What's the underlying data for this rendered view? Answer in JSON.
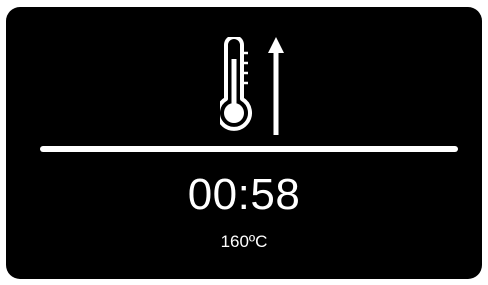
{
  "display": {
    "icon": "thermometer-rising-icon",
    "timer": "00:58",
    "temperature": "160ºC"
  },
  "colors": {
    "background": "#000000",
    "foreground": "#ffffff"
  }
}
